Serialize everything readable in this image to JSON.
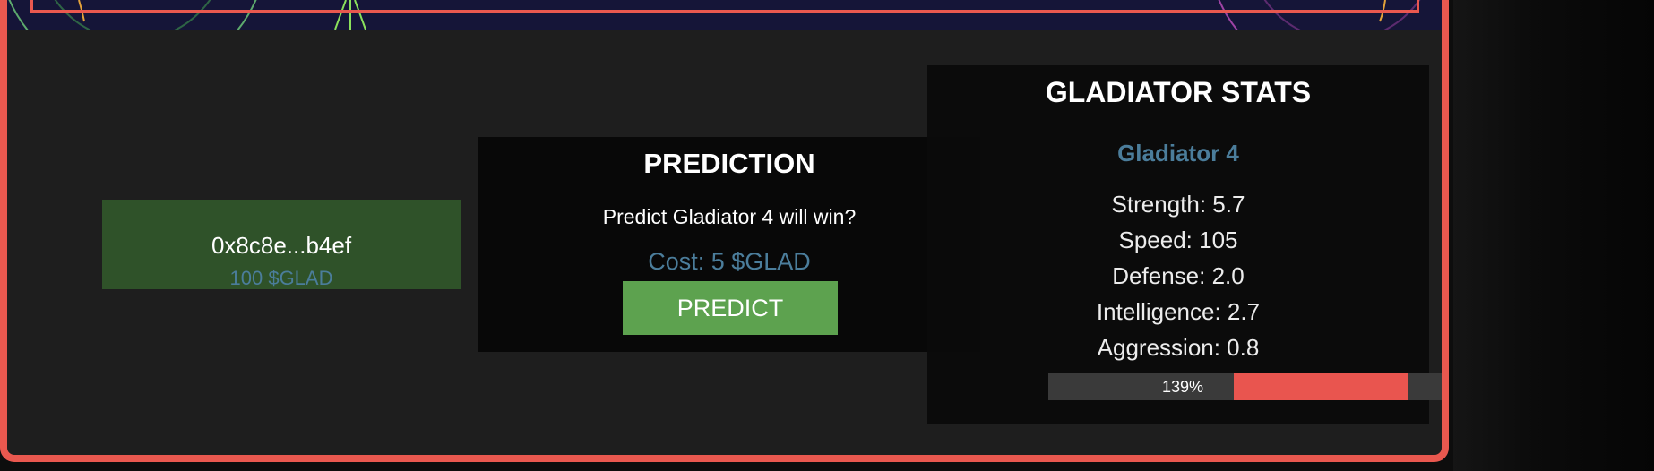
{
  "wallet": {
    "address": "0x8c8e...b4ef",
    "balance": "100 $GLAD"
  },
  "prediction": {
    "title": "PREDICTION",
    "question": "Predict Gladiator 4 will win?",
    "cost": "Cost: 5 $GLAD",
    "button_label": "PREDICT"
  },
  "stats": {
    "title": "GLADIATOR STATS",
    "gladiator_name": "Gladiator 4",
    "lines": [
      "Strength: 5.7",
      "Speed: 105",
      "Defense: 2.0",
      "Intelligence: 2.7",
      "Aggression: 0.8"
    ],
    "health_label": "139%",
    "health_percent": 139
  },
  "colors": {
    "frame_border": "#e9584f",
    "accent_blue": "#4b7d9b",
    "button_green": "#5da24f",
    "wallet_green": "#2f5229",
    "health_red": "#e9554f"
  }
}
